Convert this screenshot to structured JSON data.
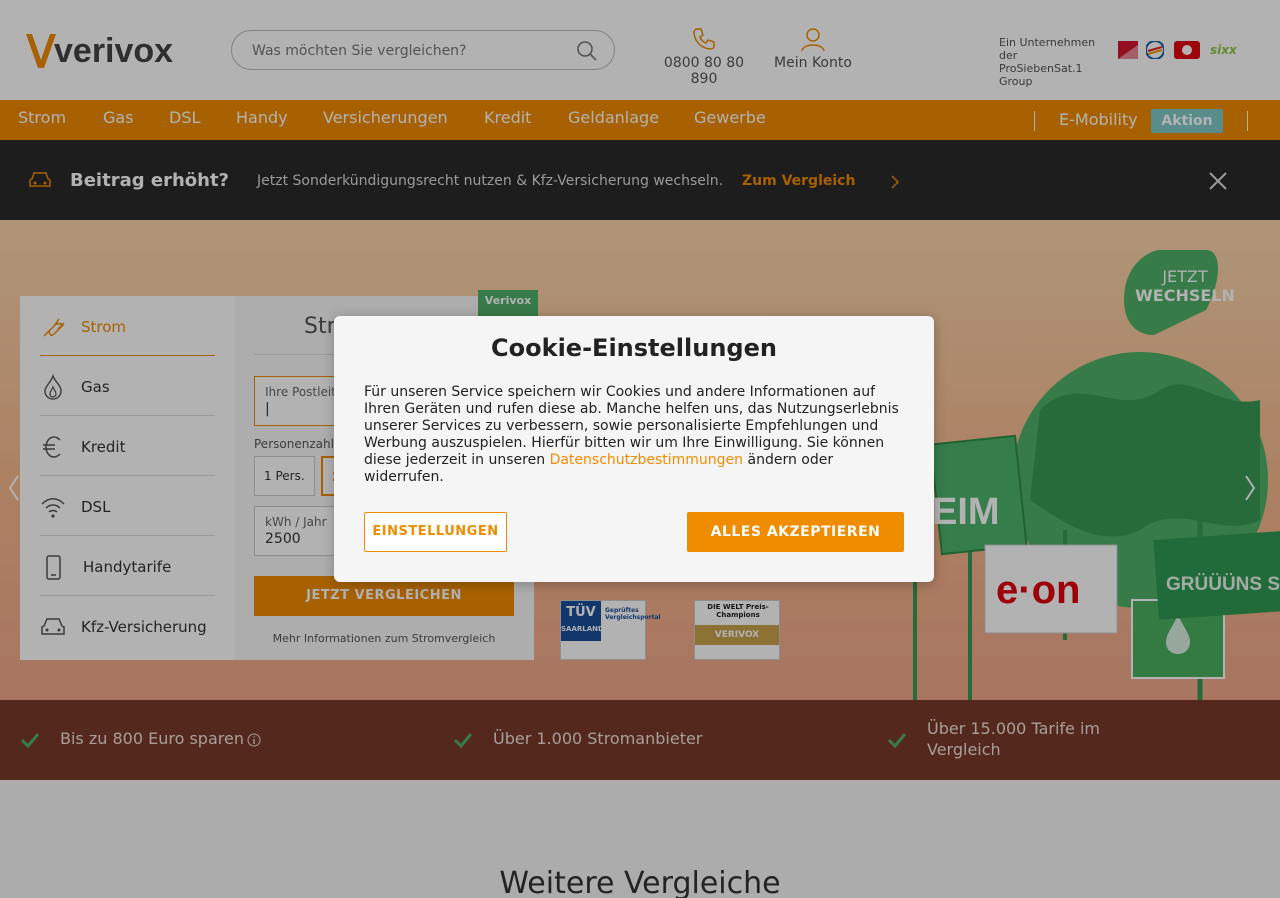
{
  "brand": {
    "logo_text": "verivox",
    "accent": "#f08c00"
  },
  "header": {
    "search_placeholder": "Was möchten Sie vergleichen?",
    "phone": "0800 80 80 890",
    "account": "Mein Konto",
    "group_text": "Ein Unternehmen der ProSiebenSat.1 Group",
    "brand_logos": [
      "ProSieben",
      "Sat.1",
      "kabel eins",
      "sixx"
    ]
  },
  "nav": {
    "items": [
      "Strom",
      "Gas",
      "DSL",
      "Handy",
      "Versicherungen",
      "Kredit",
      "Geldanlage",
      "Gewerbe"
    ],
    "emobility": "E-Mobility",
    "badge": "Aktion"
  },
  "promo": {
    "title": "Beitrag erhöht?",
    "text": "Jetzt Sonderkündigungsrecht nutzen & Kfz-Versicherung wechseln.",
    "cta": "Zum Vergleich"
  },
  "calculator": {
    "tabs": [
      "Strom",
      "Gas",
      "Kredit",
      "DSL",
      "Handytarife",
      "Kfz-Versicherung"
    ],
    "heading_fragment": "Str",
    "badge_label": "Verivox",
    "postcode_label": "Ihre Postleit",
    "persons_label": "Personenzahl",
    "persons_1": "1 Pers.",
    "persons_2_fragment": "2",
    "kwh_label": "kWh / Jahr",
    "kwh_value": "2500",
    "compare_button": "JETZT VERGLEICHEN",
    "more_info": "Mehr Informationen zum Stromvergleich"
  },
  "hero": {
    "switch_label_1": "JETZT",
    "switch_label_2": "WECHSELN",
    "eon": "e·on",
    "green_sign": "GRÜÜÜNS STROM FÜ",
    "headline_fragment": "EIM",
    "tuv_line1": "TÜV",
    "tuv_line2": "SAARLAND",
    "tuv_text": "Geprüftes Vergleichsportal",
    "welt_text": "DIE WELT Preis-Champions",
    "welt_brand": "VERIVOX"
  },
  "cookie": {
    "title": "Cookie-Einstellungen",
    "body_before": "Für unseren Service speichern wir Cookies und andere Informationen auf Ihren Geräten und rufen diese ab. Manche helfen uns, das Nutzungserlebnis unserer Services zu verbessern, sowie personalisierte Empfehlungen und Werbung auszuspielen. Hierfür bitten wir um Ihre Einwilligung. Sie können diese jederzeit in unseren ",
    "link": "Datenschutzbestimmungen",
    "body_after": " ändern oder widerrufen.",
    "settings_button": "EINSTELLUNGEN",
    "accept_button": "ALLES AKZEPTIEREN"
  },
  "benefits": [
    "Bis zu 800 Euro sparen",
    "Über 1.000 Stromanbieter",
    "Über 15.000 Tarife im Vergleich"
  ],
  "section_title": "Weitere Vergleiche"
}
